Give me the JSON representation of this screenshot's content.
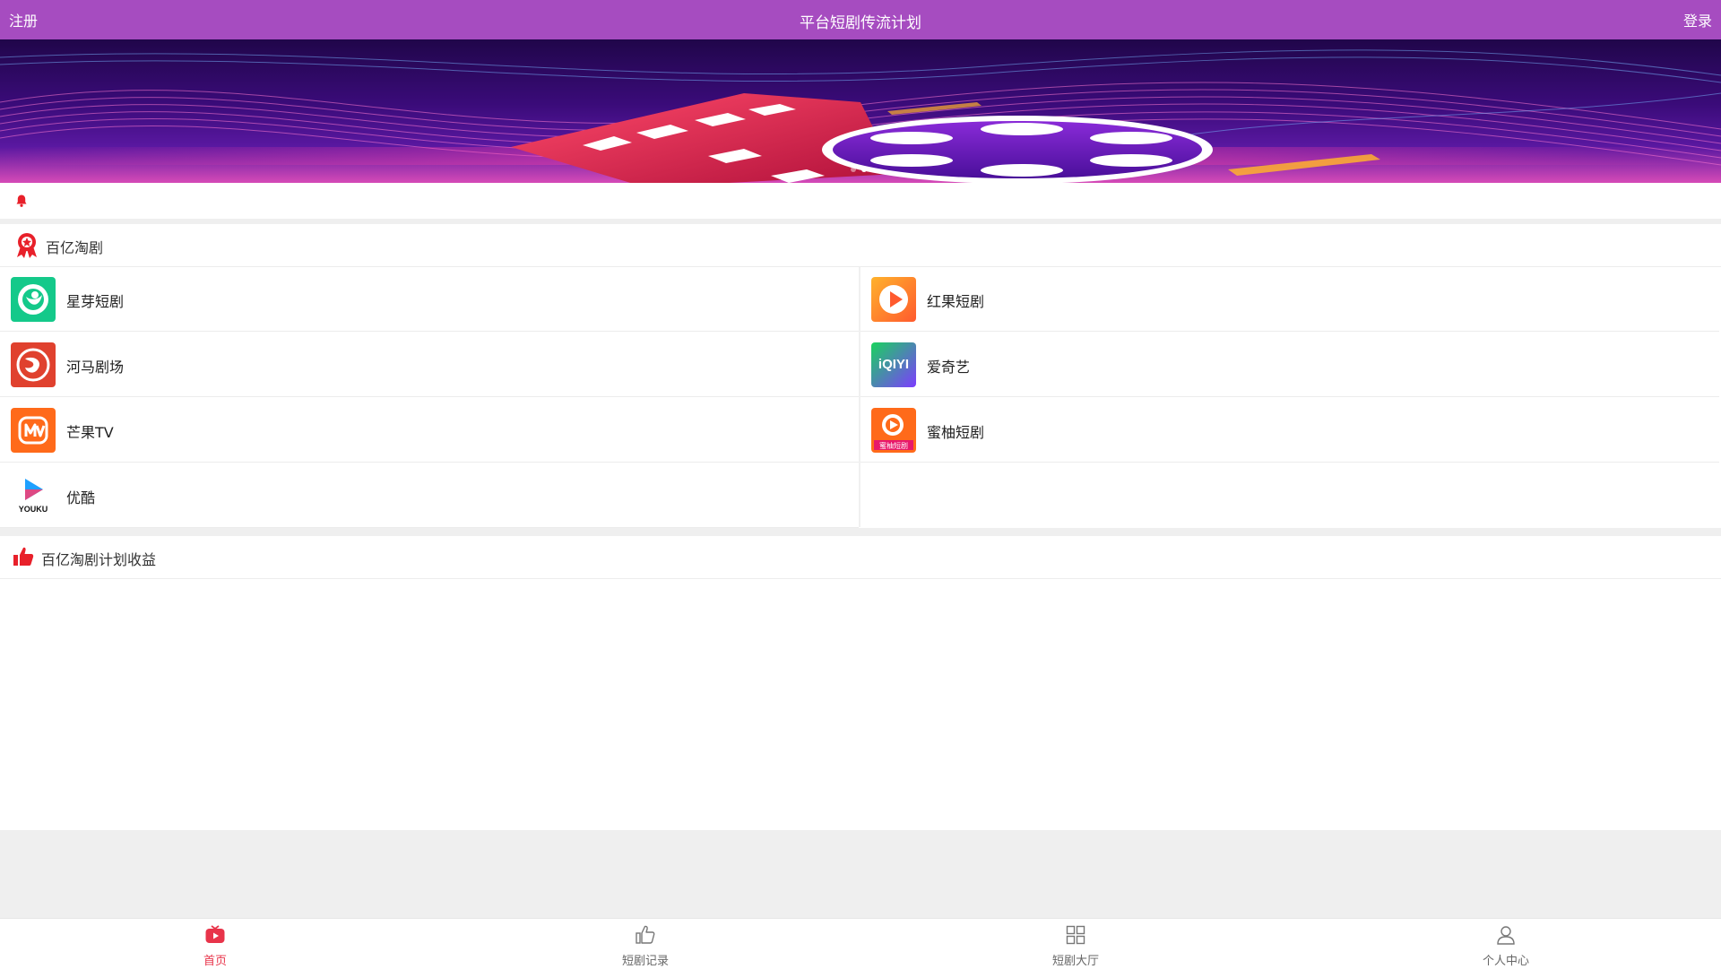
{
  "header": {
    "left_label": "注册",
    "title": "平台短剧传流计划",
    "right_label": "登录",
    "bg": "#a64cc0"
  },
  "banner": {
    "slides": 2,
    "active_slide": 2
  },
  "section1": {
    "title": "百亿淘剧",
    "icon": "ribbon-badge-icon"
  },
  "apps": [
    {
      "name": "星芽短剧",
      "icon": "xingya-logo-icon"
    },
    {
      "name": "红果短剧",
      "icon": "hongguo-logo-icon"
    },
    {
      "name": "河马剧场",
      "icon": "hema-logo-icon"
    },
    {
      "name": "爱奇艺",
      "icon": "iqiyi-logo-icon",
      "logo_text": "iQIYI"
    },
    {
      "name": "芒果TV",
      "icon": "mango-logo-icon"
    },
    {
      "name": "蜜柚短剧",
      "icon": "miyou-logo-icon",
      "logo_text": "蜜柚短剧"
    },
    {
      "name": "优酷",
      "icon": "youku-logo-icon",
      "logo_text": "YOUKU"
    }
  ],
  "section2": {
    "title": "百亿淘剧计划收益",
    "icon": "thumbs-up-icon"
  },
  "tabs": [
    {
      "label": "首页",
      "icon": "home-play-icon",
      "active": true
    },
    {
      "label": "短剧记录",
      "icon": "thumbs-up-outline-icon",
      "active": false
    },
    {
      "label": "短剧大厅",
      "icon": "grid-icon",
      "active": false
    },
    {
      "label": "个人中心",
      "icon": "person-icon",
      "active": false
    }
  ],
  "colors": {
    "accent": "#e8344a",
    "header": "#a64cc0"
  }
}
